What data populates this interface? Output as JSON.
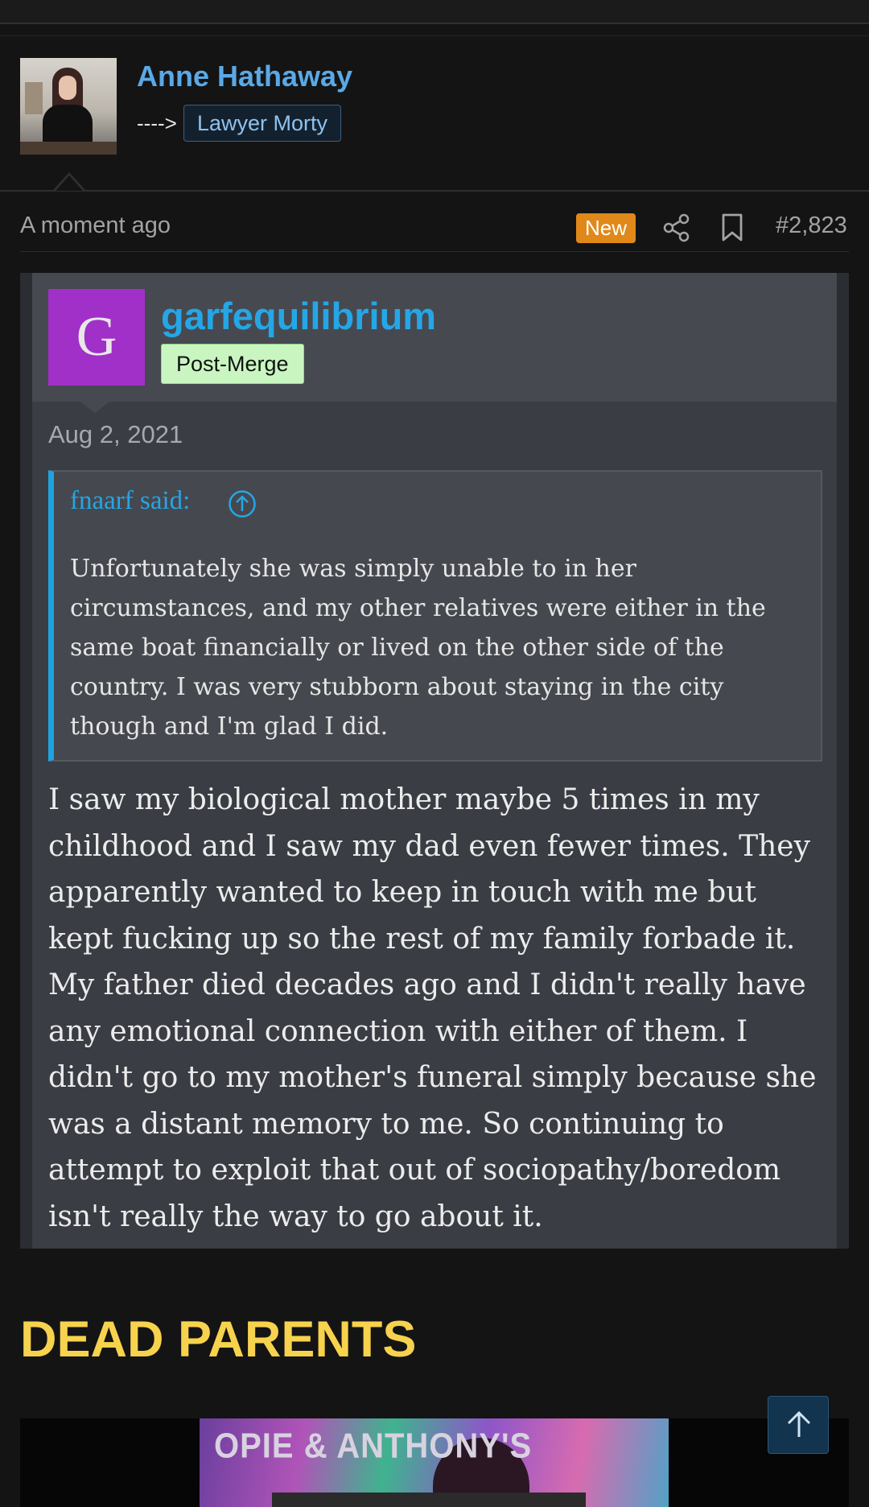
{
  "author": {
    "name": "Anne Hathaway",
    "arrow": "---->",
    "badge": "Lawyer Morty"
  },
  "meta": {
    "time": "A moment ago",
    "new_label": "New",
    "post_number": "#2,823",
    "icons": [
      "share-icon",
      "bookmark-icon"
    ]
  },
  "quoted_post": {
    "avatar_letter": "G",
    "avatar_color": "#a030c8",
    "username": "garfequilibrium",
    "badge": "Post-Merge",
    "date": "Aug 2, 2021",
    "blockquote": {
      "author": "fnaarf said:",
      "text": "Unfortunately she was simply unable to in her circumstances, and my other relatives were either in the same boat financially or lived on the other side of the country. I was very stubborn about staying in the city though and I'm glad I did."
    },
    "text": "I saw my biological mother maybe 5 times in my childhood and I saw my dad even fewer times. They apparently wanted to keep in touch with me but kept fucking up so the rest of my family forbade it. My father died decades ago and I didn't really have any emotional connection with either of them. I didn't go to my mother's funeral simply because she was a distant memory to me. So continuing to attempt to exploit that out of sociopathy/boredom isn't really the way to go about it."
  },
  "headline": "DEAD PARENTS",
  "embed": {
    "caption": "OPIE & ANTHONY'S"
  },
  "colors": {
    "link": "#25a6e6",
    "headline": "#f7d24d",
    "new_badge": "#e0891a",
    "post_merge_badge": "#c9f6c0"
  }
}
